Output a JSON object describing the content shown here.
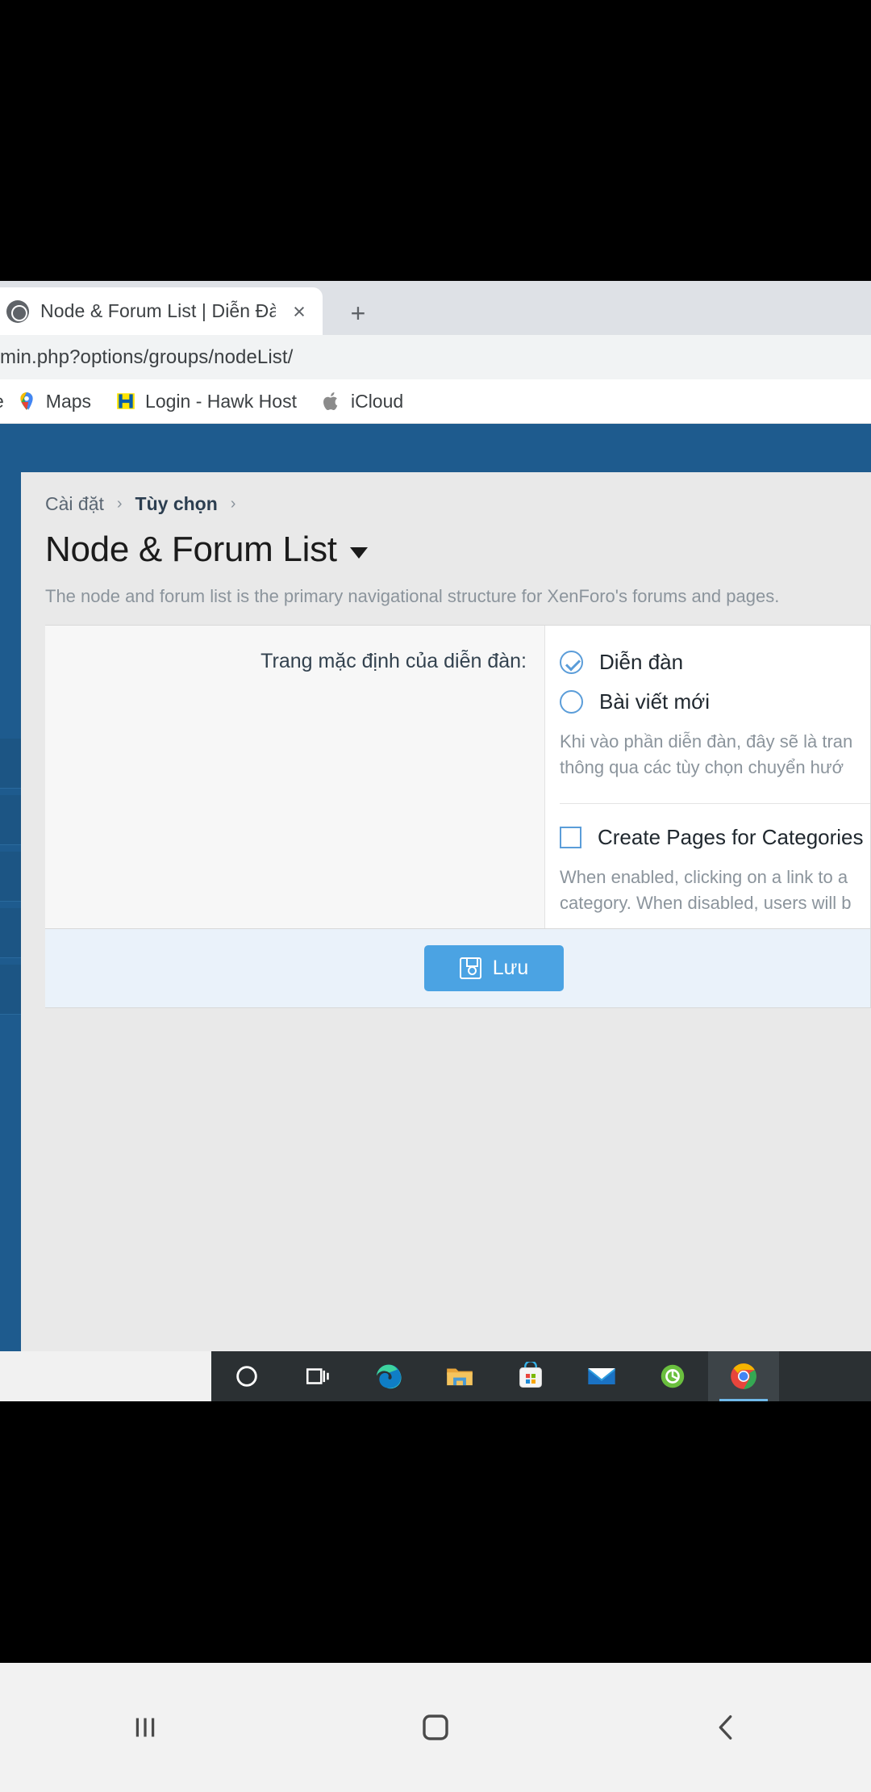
{
  "browser": {
    "tab": {
      "title": "Node & Forum List | Diễn Đàn Hà",
      "favicon": "globe-icon",
      "close": "×"
    },
    "new_tab_label": "+",
    "address_bar": {
      "value": "min.php?options/groups/nodeList/"
    },
    "bookmarks": [
      {
        "label": "e",
        "icon": "partial-bookmark-icon"
      },
      {
        "label": "Maps",
        "icon": "google-maps-icon"
      },
      {
        "label": "Login - Hawk Host",
        "icon": "hawkhost-h-icon"
      },
      {
        "label": "iCloud",
        "icon": "apple-icon"
      }
    ]
  },
  "xenforo": {
    "breadcrumb": {
      "item1": "Cài đặt",
      "sep1": "›",
      "item2": "Tùy chọn",
      "sep2": "›"
    },
    "page_title": "Node & Forum List",
    "page_description": "The node and forum list is the primary navigational structure for XenForo's forums and pages.",
    "form": {
      "label": "Trang mặc định của diễn đàn:",
      "radios": [
        {
          "label": "Diễn đàn",
          "checked": true
        },
        {
          "label": "Bài viết mới",
          "checked": false
        }
      ],
      "radio_hint_line1": "Khi vào phần diễn đàn, đây sẽ là tran",
      "radio_hint_line2": "thông qua các tùy chọn chuyển hướ",
      "checkbox": {
        "label": "Create Pages for Categories",
        "checked": false
      },
      "checkbox_hint_line1": "When enabled, clicking on a link to a",
      "checkbox_hint_line2": "category. When disabled, users will b",
      "save_button": "Lưu",
      "save_icon": "floppy-disk-icon"
    }
  },
  "taskbar": {
    "items": [
      {
        "name": "cortana-icon"
      },
      {
        "name": "task-view-icon"
      },
      {
        "name": "microsoft-edge-icon"
      },
      {
        "name": "file-explorer-icon"
      },
      {
        "name": "microsoft-store-icon"
      },
      {
        "name": "mail-icon"
      },
      {
        "name": "green-app-icon"
      },
      {
        "name": "chrome-icon"
      }
    ]
  },
  "android_nav": {
    "recents": "|||",
    "home": "home-square-icon",
    "back": "‹"
  },
  "colors": {
    "xf_header_blue": "#1e5b8e",
    "accent_blue": "#4ba3e3",
    "radio_blue": "#5b9dd9",
    "taskbar": "#2b3033"
  }
}
